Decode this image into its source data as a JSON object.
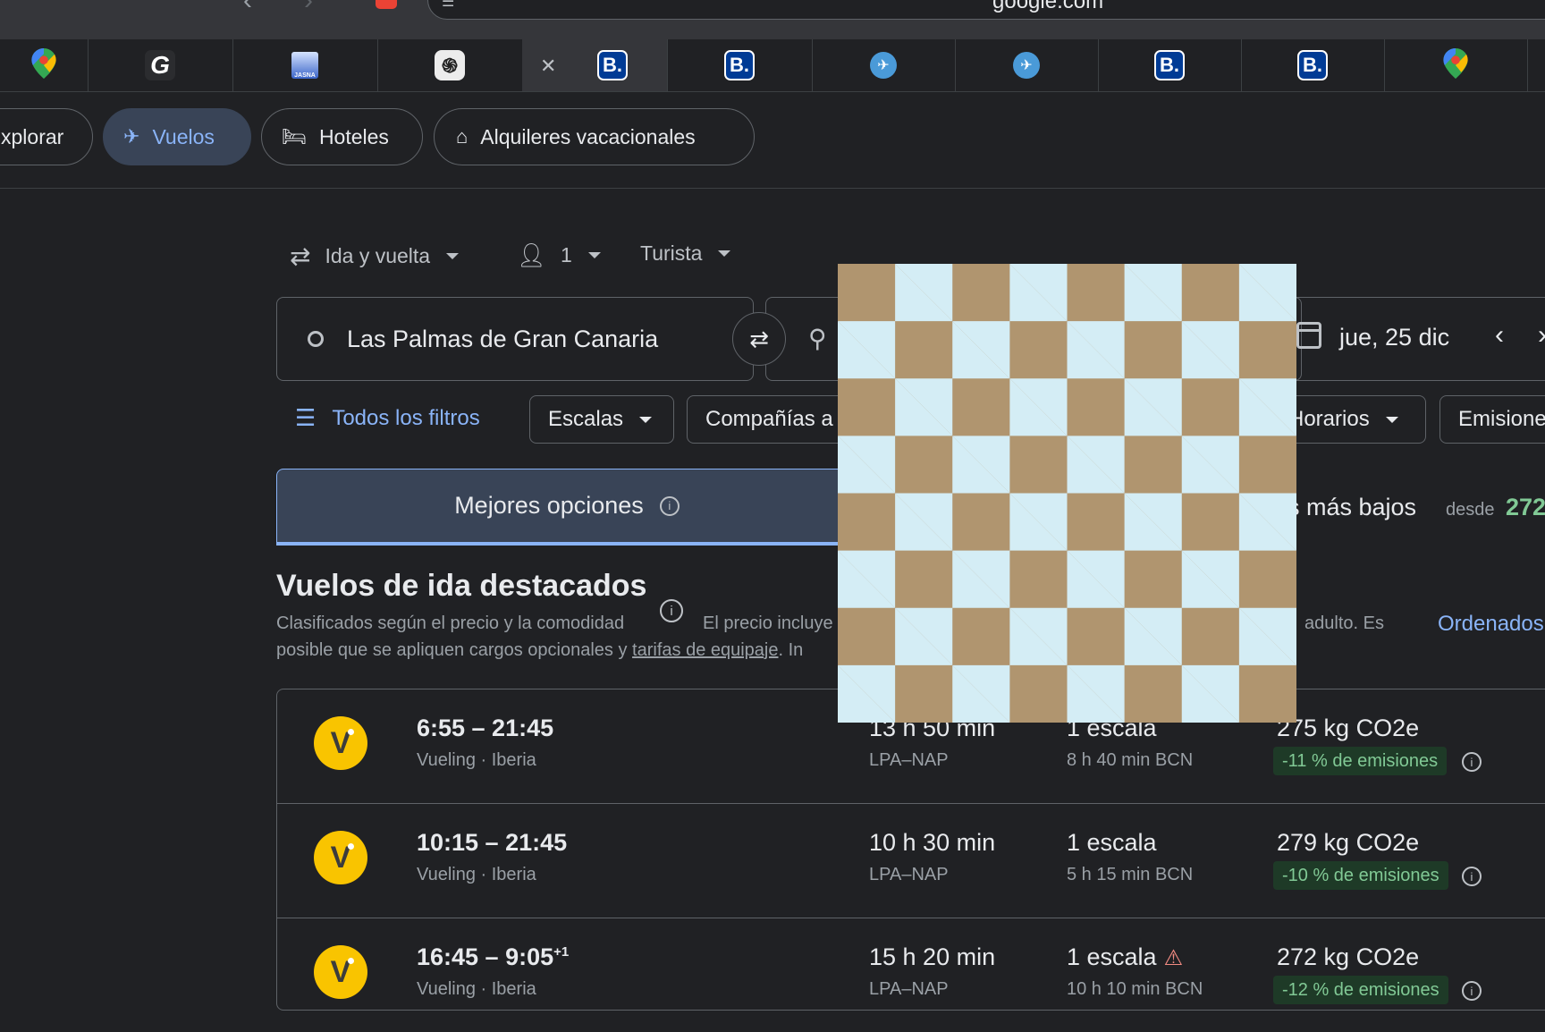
{
  "browser": {
    "url": "google.com",
    "tabs": [
      {
        "icon": "google-maps-icon",
        "active": false
      },
      {
        "icon": "grammarly-icon",
        "label": "G",
        "active": false
      },
      {
        "icon": "jasna-icon",
        "label": "JASNA",
        "active": false
      },
      {
        "icon": "chatgpt-icon",
        "label": "֍",
        "active": false
      },
      {
        "icon": "booking-icon",
        "label": "B.",
        "active": true
      },
      {
        "icon": "booking-icon",
        "label": "B.",
        "active": false
      },
      {
        "icon": "plane-app-icon",
        "label": "✈",
        "active": false
      },
      {
        "icon": "plane-app-icon",
        "label": "✈",
        "active": false
      },
      {
        "icon": "booking-icon",
        "label": "B.",
        "active": false
      },
      {
        "icon": "booking-icon",
        "label": "B.",
        "active": false
      },
      {
        "icon": "google-maps-icon",
        "active": false
      }
    ]
  },
  "nav_chips": {
    "explore": "xplorar",
    "flights": "Vuelos",
    "hotels": "Hoteles",
    "rentals": "Alquileres vacacionales"
  },
  "options": {
    "trip_type": "Ida y vuelta",
    "passengers": "1",
    "cabin": "Turista"
  },
  "search": {
    "origin": "Las Palmas de Gran Canaria",
    "date": "jue, 25 dic"
  },
  "filters": {
    "all": "Todos los filtros",
    "stops": "Escalas",
    "airlines": "Compañías a",
    "times": "Horarios",
    "emissions": "Emisione"
  },
  "tabs": {
    "best": "Mejores opciones",
    "cheapest": "s más bajos",
    "cheapest_from": "desde",
    "cheapest_price": "272"
  },
  "section": {
    "title": "Vuelos de ida destacados",
    "subtitle_1": "Clasificados según el precio y la comodidad",
    "price_note_1": "El precio incluye",
    "price_note_2": "adulto. Es",
    "sort": "Ordenados",
    "subtitle_2_pre": "posible que se apliquen cargos opcionales y ",
    "baggage_link": "tarifas de equipaje",
    "subtitle_2_post": ". In"
  },
  "flights": [
    {
      "logo": "V",
      "times": "6:55 – 21:45",
      "plus_day": "",
      "airlines": "Vueling · Iberia",
      "duration": "13 h 50 min",
      "route": "LPA–NAP",
      "stops": "1 escala",
      "warning": false,
      "layover": "8 h 40 min BCN",
      "co2": "275 kg CO2e",
      "emissions": "-11 % de emisiones"
    },
    {
      "logo": "V",
      "times": "10:15 – 21:45",
      "plus_day": "",
      "airlines": "Vueling · Iberia",
      "duration": "10 h 30 min",
      "route": "LPA–NAP",
      "stops": "1 escala",
      "warning": false,
      "layover": "5 h 15 min BCN",
      "co2": "279 kg CO2e",
      "emissions": "-10 % de emisiones"
    },
    {
      "logo": "V",
      "times": "16:45 – 9:05",
      "plus_day": "+1",
      "airlines": "Vueling · Iberia",
      "duration": "15 h 20 min",
      "route": "LPA–NAP",
      "stops": "1 escala",
      "warning": true,
      "layover": "10 h 10 min BCN",
      "co2": "272 kg CO2e",
      "emissions": "-12 % de emisiones"
    }
  ],
  "colors": {
    "background": "#202124",
    "accent": "#8ab4f8",
    "selected_chip": "#394457",
    "price_green": "#81c995",
    "checker_tan": "#b0956f",
    "checker_light": "#d4edf5"
  }
}
